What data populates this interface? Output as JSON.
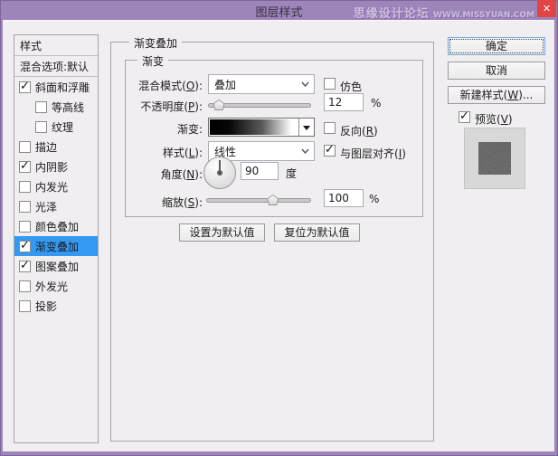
{
  "colors": {
    "titlebar_purple": "#9d85ba",
    "close_red": "#e04444",
    "selection_blue": "#3399f3",
    "client_bg": "#f0eef0",
    "gradient_start": "#000000",
    "gradient_end": "#ffffff"
  },
  "window": {
    "title": "图层样式",
    "watermark_name": "思缘设计论坛",
    "watermark_url": "WWW.MISSYUAN.COM",
    "close_glyph": "✕"
  },
  "sidebar": {
    "items": [
      {
        "label": "样式"
      },
      {
        "label": "混合选项:默认"
      },
      {
        "label": "斜面和浮雕",
        "checked": true
      },
      {
        "label": "等高线",
        "checked": false
      },
      {
        "label": "纹理",
        "checked": false
      },
      {
        "label": "描边",
        "checked": false
      },
      {
        "label": "内阴影",
        "checked": true
      },
      {
        "label": "内发光",
        "checked": false
      },
      {
        "label": "光泽",
        "checked": false
      },
      {
        "label": "颜色叠加",
        "checked": false
      },
      {
        "label": "渐变叠加",
        "checked": true,
        "selected": true
      },
      {
        "label": "图案叠加",
        "checked": true
      },
      {
        "label": "外发光",
        "checked": false
      },
      {
        "label": "投影",
        "checked": false
      }
    ]
  },
  "panel": {
    "group_title": "渐变叠加",
    "subgroup_title": "渐变",
    "blend_mode": {
      "pre": "混合模式(",
      "key": "O",
      "post": "):",
      "value": "叠加"
    },
    "dither": {
      "label": "仿色",
      "checked": false
    },
    "opacity": {
      "pre": "不透明度(",
      "key": "P",
      "post": "):",
      "value": "12",
      "unit": "%",
      "slider_percent": 11
    },
    "gradient": {
      "label": "渐变:"
    },
    "reverse": {
      "pre": "反向(",
      "key": "R",
      "post": ")",
      "checked": false
    },
    "style": {
      "pre": "样式(",
      "key": "L",
      "post": "):",
      "value": "线性"
    },
    "align": {
      "pre": "与图层对齐(",
      "key": "I",
      "post": ")",
      "checked": true
    },
    "angle": {
      "pre": "角度(",
      "key": "N",
      "post": "):",
      "value": "90",
      "unit": "度"
    },
    "scale": {
      "pre": "缩放(",
      "key": "S",
      "post": "):",
      "value": "100",
      "unit": "%",
      "slider_percent": 64
    },
    "set_default": "设置为默认值",
    "reset_default": "复位为默认值"
  },
  "actions": {
    "ok": "确定",
    "cancel": "取消",
    "new_style": {
      "pre": "新建样式(",
      "key": "W",
      "post": ")..."
    },
    "preview": {
      "pre": "预览(",
      "key": "V",
      "post": ")",
      "checked": true
    }
  }
}
